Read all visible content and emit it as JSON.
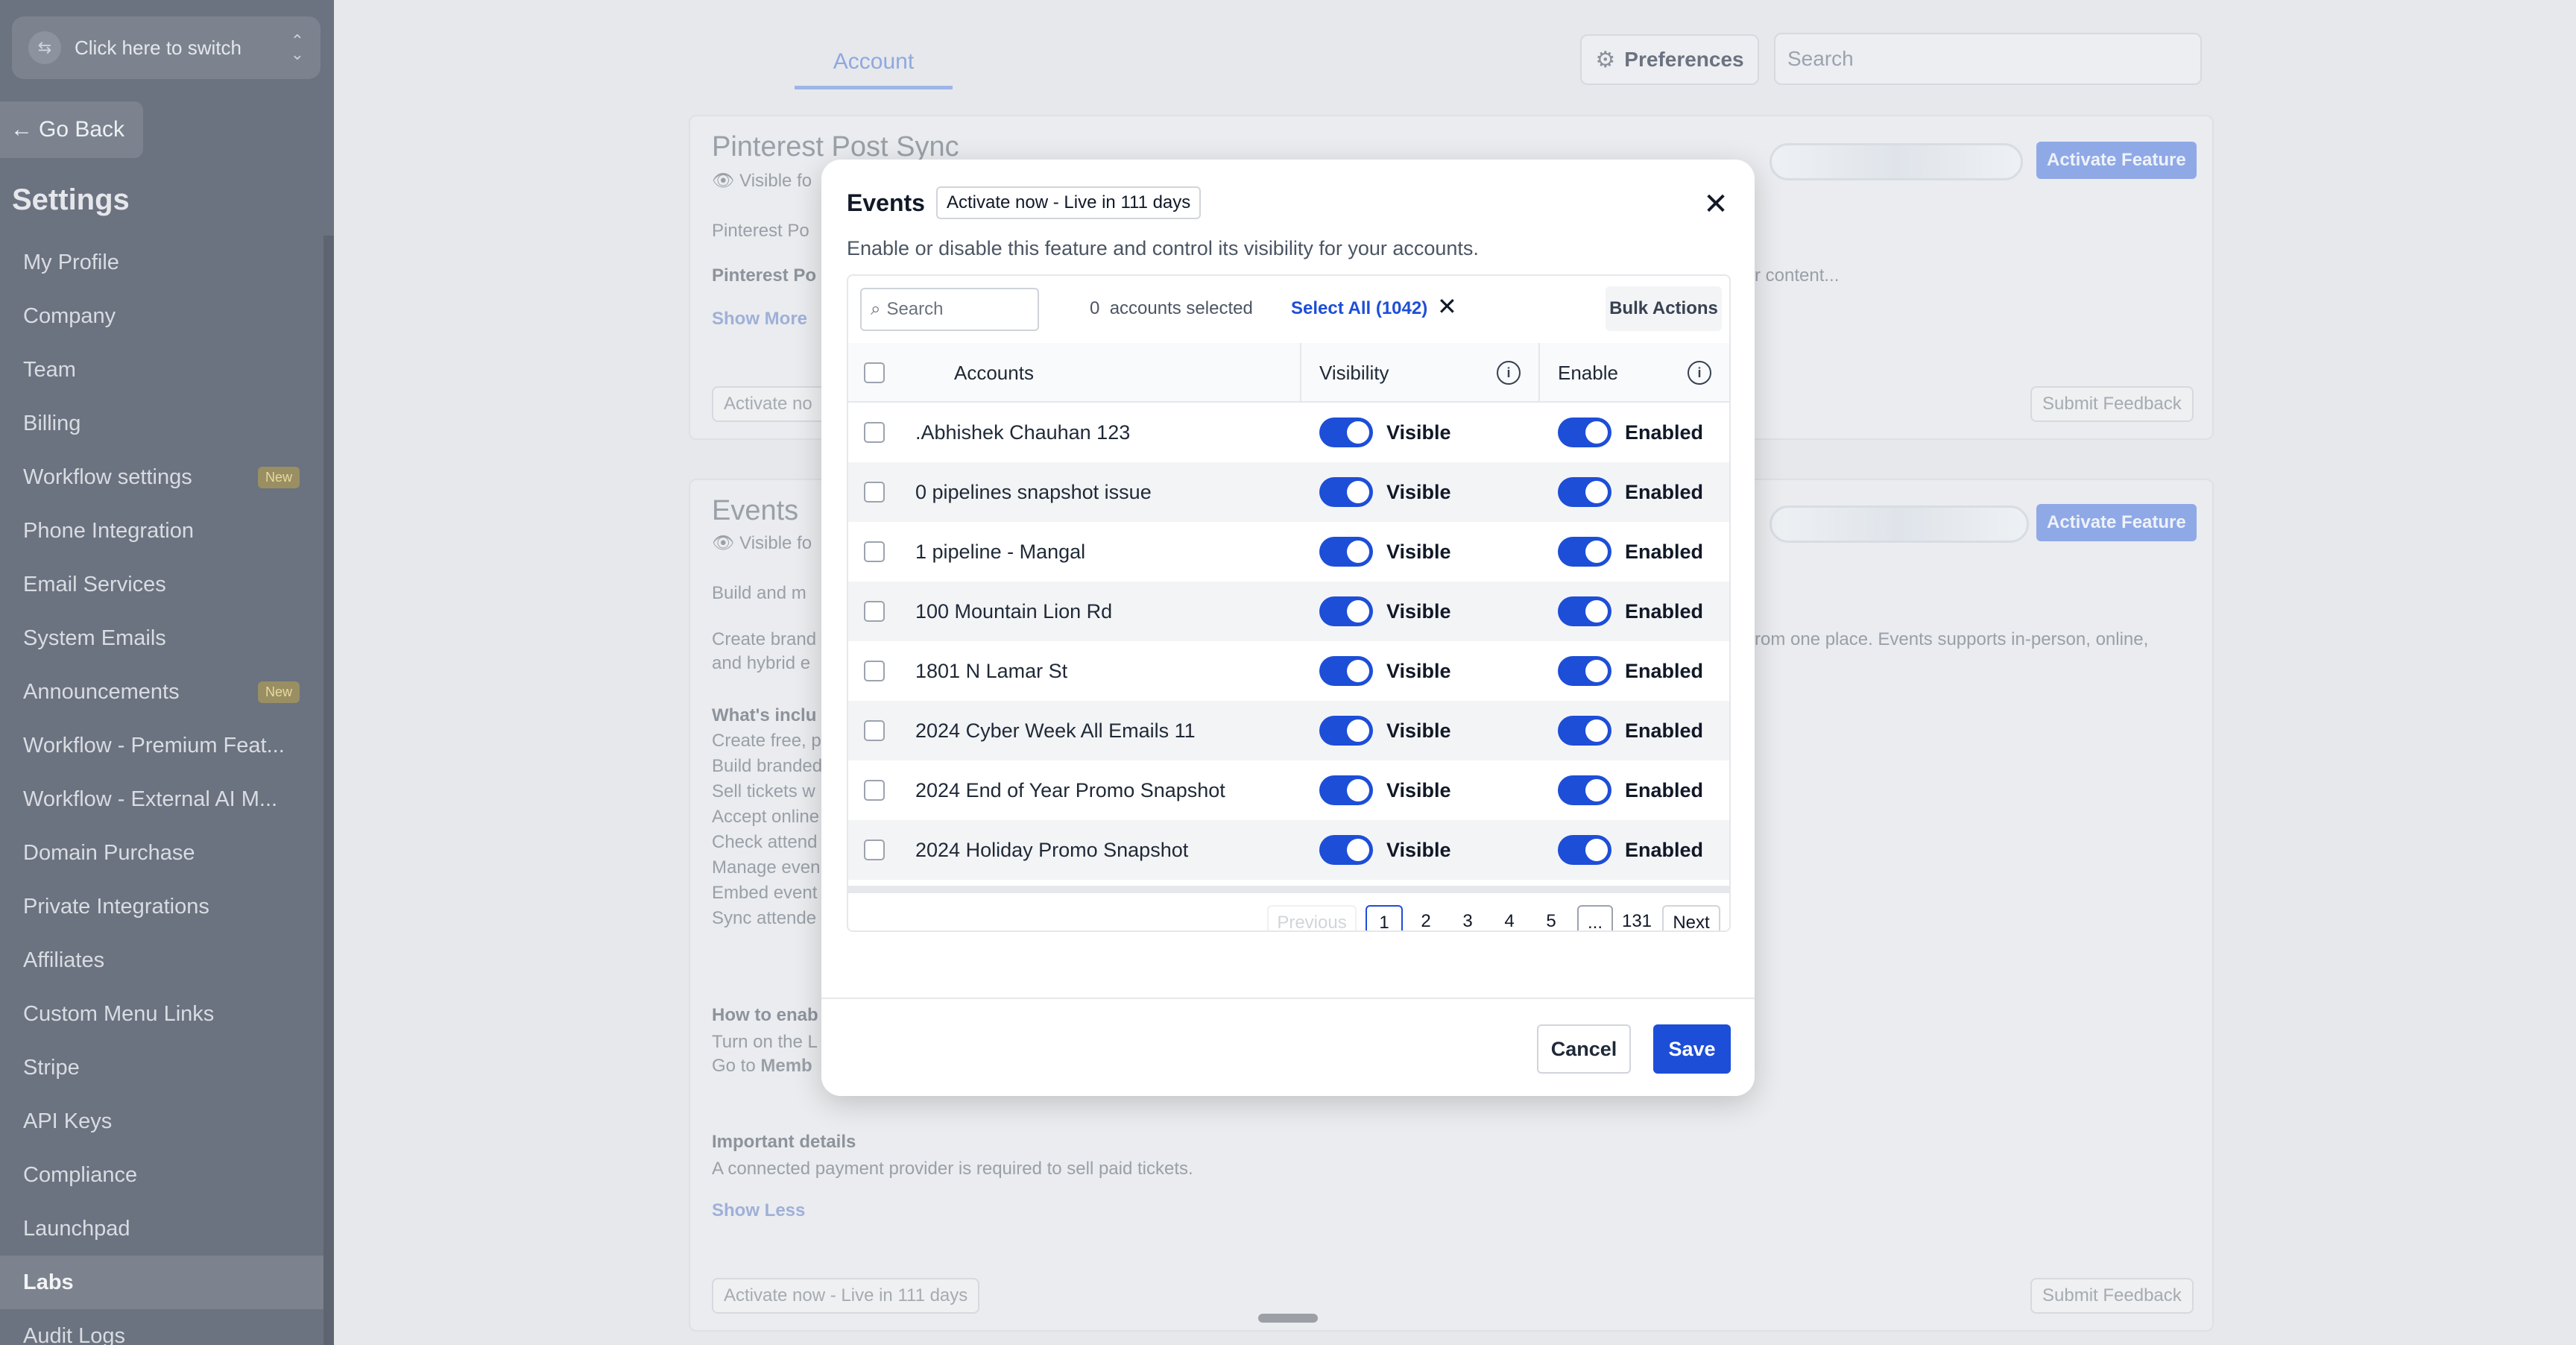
{
  "sidebar": {
    "switcher_label": "Click here to switch",
    "go_back": "Go Back",
    "title": "Settings",
    "items": [
      {
        "label": "My Profile",
        "badge": ""
      },
      {
        "label": "Company",
        "badge": ""
      },
      {
        "label": "Team",
        "badge": ""
      },
      {
        "label": "Billing",
        "badge": ""
      },
      {
        "label": "Workflow settings",
        "badge": "New"
      },
      {
        "label": "Phone Integration",
        "badge": ""
      },
      {
        "label": "Email Services",
        "badge": ""
      },
      {
        "label": "System Emails",
        "badge": ""
      },
      {
        "label": "Announcements",
        "badge": "New"
      },
      {
        "label": "Workflow - Premium Feat...",
        "badge": ""
      },
      {
        "label": "Workflow - External AI M...",
        "badge": ""
      },
      {
        "label": "Domain Purchase",
        "badge": ""
      },
      {
        "label": "Private Integrations",
        "badge": ""
      },
      {
        "label": "Affiliates",
        "badge": ""
      },
      {
        "label": "Custom Menu Links",
        "badge": ""
      },
      {
        "label": "Stripe",
        "badge": ""
      },
      {
        "label": "API Keys",
        "badge": ""
      },
      {
        "label": "Compliance",
        "badge": ""
      },
      {
        "label": "Launchpad",
        "badge": ""
      },
      {
        "label": "Labs",
        "badge": ""
      },
      {
        "label": "Audit Logs",
        "badge": ""
      }
    ],
    "active_index": 19
  },
  "header": {
    "tab_account": "Account",
    "preferences": "Preferences",
    "search_placeholder": "Search"
  },
  "background": {
    "card1": {
      "title": "Pinterest Post Sync",
      "visible_for": "Visible fo",
      "line1": "Pinterest Po",
      "line2": "Pinterest Po",
      "line2_tail": "r content...",
      "show_more": "Show More",
      "activate_now": "Activate no",
      "activate_feature": "Activate Feature",
      "submit_feedback": "Submit Feedback"
    },
    "card2": {
      "title": "Events",
      "visible_for": "Visible fo",
      "build": "Build and m",
      "create_a": "Create brand",
      "create_b": "and hybrid e",
      "create_tail": "rom one place. Events supports in-person, online,",
      "whats_included": "What's inclu",
      "list": [
        "Create free, p",
        "Build branded",
        "Sell tickets w",
        "Accept online",
        "Check attend",
        "Manage even",
        "Embed event",
        "Sync attende"
      ],
      "how_to": "How to enab",
      "turn_on": "Turn on the L",
      "go_to": "Go to",
      "go_to_bold": "Memb",
      "important": "Important details",
      "important_text": "A connected payment provider is required to sell paid tickets.",
      "show_less": "Show Less",
      "activate_now": "Activate now - Live in 111 days",
      "activate_feature": "Activate Feature",
      "submit_feedback": "Submit Feedback"
    }
  },
  "modal": {
    "title": "Events",
    "tag": "Activate now - Live in 111 days",
    "subtitle": "Enable or disable this feature and control its visibility for your accounts.",
    "toolbar": {
      "search_placeholder": "Search",
      "selected_count": "0",
      "selected_text": "accounts selected",
      "select_all": "Select All (1042)",
      "bulk_actions": "Bulk Actions"
    },
    "columns": {
      "accounts": "Accounts",
      "visibility": "Visibility",
      "enable": "Enable"
    },
    "rows": [
      {
        "name": ".Abhishek Chauhan 123",
        "visibility": "Visible",
        "enable": "Enabled"
      },
      {
        "name": "0 pipelines snapshot issue",
        "visibility": "Visible",
        "enable": "Enabled"
      },
      {
        "name": "1 pipeline - Mangal",
        "visibility": "Visible",
        "enable": "Enabled"
      },
      {
        "name": "100 Mountain Lion Rd",
        "visibility": "Visible",
        "enable": "Enabled"
      },
      {
        "name": "1801 N Lamar St",
        "visibility": "Visible",
        "enable": "Enabled"
      },
      {
        "name": "2024 Cyber Week All Emails 11",
        "visibility": "Visible",
        "enable": "Enabled"
      },
      {
        "name": "2024 End of Year Promo Snapshot",
        "visibility": "Visible",
        "enable": "Enabled"
      },
      {
        "name": "2024 Holiday Promo Snapshot",
        "visibility": "Visible",
        "enable": "Enabled"
      }
    ],
    "pagination": {
      "previous": "Previous",
      "pages": [
        "1",
        "2",
        "3",
        "4",
        "5"
      ],
      "ellipsis": "...",
      "last": "131",
      "next": "Next",
      "current": "1"
    },
    "cancel": "Cancel",
    "save": "Save"
  }
}
